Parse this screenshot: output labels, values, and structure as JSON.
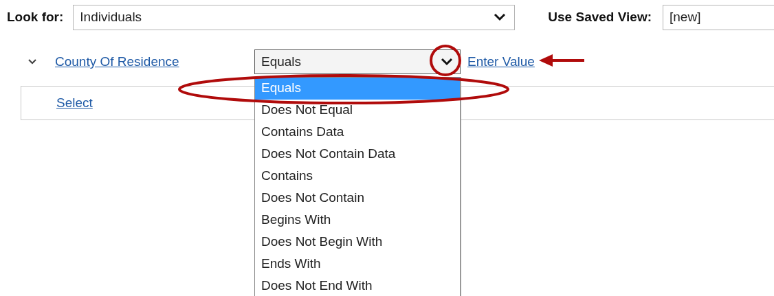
{
  "look_for": {
    "label": "Look for:",
    "value": "Individuals"
  },
  "saved_view": {
    "label": "Use Saved View:",
    "value": "[new]"
  },
  "condition": {
    "expanded": true,
    "field": "County Of Residence",
    "operator": "Equals",
    "value_link": "Enter Value",
    "dropdown_open": true,
    "options": [
      {
        "label": "Equals",
        "selected": true
      },
      {
        "label": "Does Not Equal",
        "selected": false
      },
      {
        "label": "Contains Data",
        "selected": false
      },
      {
        "label": "Does Not Contain Data",
        "selected": false
      },
      {
        "label": "Contains",
        "selected": false
      },
      {
        "label": "Does Not Contain",
        "selected": false
      },
      {
        "label": "Begins With",
        "selected": false
      },
      {
        "label": "Does Not Begin With",
        "selected": false
      },
      {
        "label": "Ends With",
        "selected": false
      },
      {
        "label": "Does Not End With",
        "selected": false
      }
    ]
  },
  "select_link": "Select"
}
